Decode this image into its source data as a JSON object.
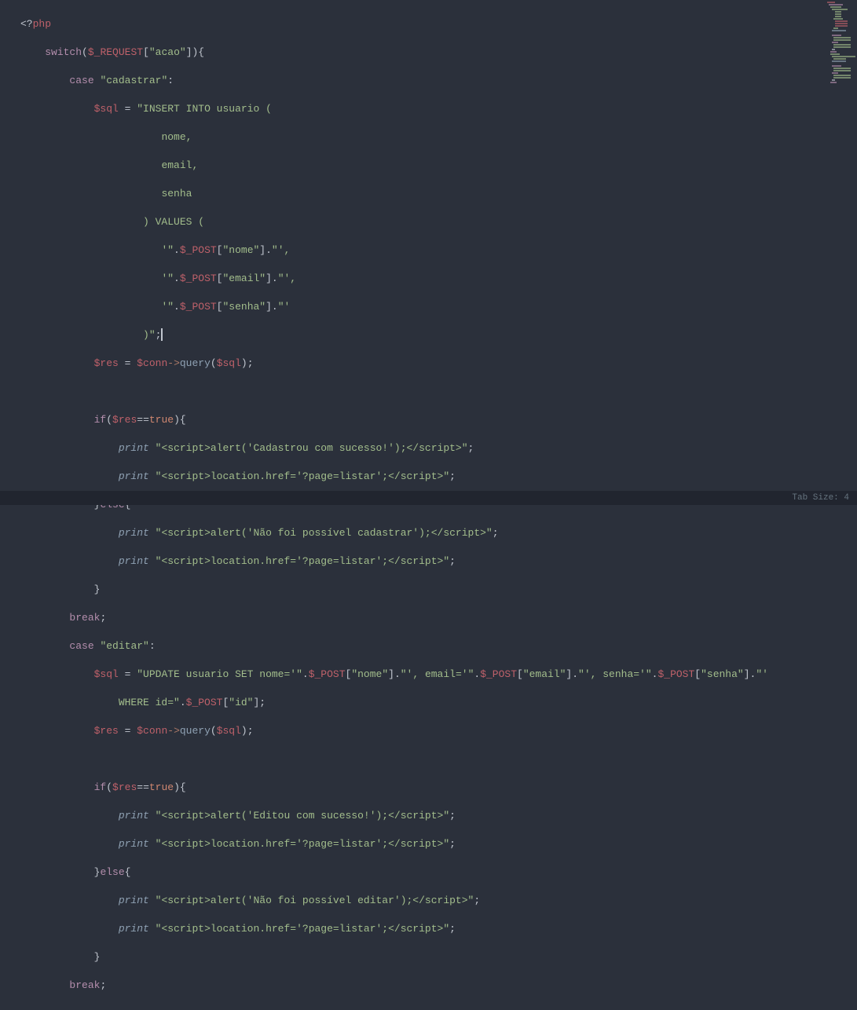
{
  "status": {
    "tab_size": "Tab Size: 4"
  },
  "code": {
    "l1": {
      "a": "<?",
      "b": "php"
    },
    "l2": {
      "a": "switch",
      "b": "$_REQUEST",
      "c": "[",
      "d": "\"acao\"",
      "e": "]){"
    },
    "l3": {
      "a": "case",
      "b": " ",
      "c": "\"cadastrar\"",
      "d": ":"
    },
    "l4": {
      "a": "$sql",
      "b": " = ",
      "c": "\"INSERT INTO usuario ("
    },
    "l5": {
      "a": "nome,"
    },
    "l6": {
      "a": "email,"
    },
    "l7": {
      "a": "senha"
    },
    "l8": {
      "a": ") VALUES ("
    },
    "l9": {
      "a": "'\"",
      "b": ".",
      "c": "$_POST",
      "d": "[",
      "e": "\"nome\"",
      "f": "].",
      "g": "\"',"
    },
    "l10": {
      "a": "'\"",
      "b": ".",
      "c": "$_POST",
      "d": "[",
      "e": "\"email\"",
      "f": "].",
      "g": "\"',"
    },
    "l11": {
      "a": "'\"",
      "b": ".",
      "c": "$_POST",
      "d": "[",
      "e": "\"senha\"",
      "f": "].",
      "g": "\"'"
    },
    "l12": {
      "a": ")\"",
      "b": ";"
    },
    "l13": {
      "a": "$res",
      "b": " = ",
      "c": "$conn",
      "d": "->",
      "e": "query",
      "f": "(",
      "g": "$sql",
      "h": ");"
    },
    "l14": {
      "a": "if",
      "b": "(",
      "c": "$res",
      "d": "==",
      "e": "true",
      "f": "){"
    },
    "l15": {
      "a": "print",
      "b": " ",
      "c": "\"<script>alert('Cadastrou com sucesso!');</script>\"",
      "d": ";"
    },
    "l16": {
      "a": "print",
      "b": " ",
      "c": "\"<script>location.href='?page=listar';</script>\"",
      "d": ";"
    },
    "l17": {
      "a": "}",
      "b": "else",
      "c": "{"
    },
    "l18": {
      "a": "print",
      "b": " ",
      "c": "\"<script>alert('Não foi possível cadastrar');</script>\"",
      "d": ";"
    },
    "l19": {
      "a": "print",
      "b": " ",
      "c": "\"<script>location.href='?page=listar';</script>\"",
      "d": ";"
    },
    "l20": {
      "a": "}"
    },
    "l21": {
      "a": "break",
      "b": ";"
    },
    "l22": {
      "a": "case",
      "b": " ",
      "c": "\"editar\"",
      "d": ":"
    },
    "l23": {
      "a": "$sql",
      "b": " = ",
      "c": "\"UPDATE usuario SET nome='\"",
      "d": ".",
      "e": "$_POST",
      "f": "[",
      "g": "\"nome\"",
      "h": "].",
      "i": "\"', email='\"",
      "j": ".",
      "k": "$_POST",
      "l": "[",
      "m": "\"email\"",
      "n": "].",
      "o": "\"', senha='\"",
      "p": ".",
      "q": "$_POST",
      "r": "[",
      "s": "\"senha\"",
      "t": "].",
      "u": "\"'"
    },
    "l24": {
      "a": "WHERE id=\"",
      "b": ".",
      "c": "$_POST",
      "d": "[",
      "e": "\"id\"",
      "f": "];"
    },
    "l25": {
      "a": "$res",
      "b": " = ",
      "c": "$conn",
      "d": "->",
      "e": "query",
      "f": "(",
      "g": "$sql",
      "h": ");"
    },
    "l26": {
      "a": "if",
      "b": "(",
      "c": "$res",
      "d": "==",
      "e": "true",
      "f": "){"
    },
    "l27": {
      "a": "print",
      "b": " ",
      "c": "\"<script>alert('Editou com sucesso!');</script>\"",
      "d": ";"
    },
    "l28": {
      "a": "print",
      "b": " ",
      "c": "\"<script>location.href='?page=listar';</script>\"",
      "d": ";"
    },
    "l29": {
      "a": "}",
      "b": "else",
      "c": "{"
    },
    "l30": {
      "a": "print",
      "b": " ",
      "c": "\"<script>alert('Não foi possível editar');</script>\"",
      "d": ";"
    },
    "l31": {
      "a": "print",
      "b": " ",
      "c": "\"<script>location.href='?page=listar';</script>\"",
      "d": ";"
    },
    "l32": {
      "a": "}"
    },
    "l33": {
      "a": "break",
      "b": ";"
    }
  }
}
